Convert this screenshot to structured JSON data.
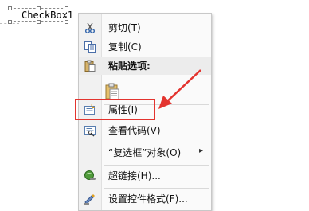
{
  "checkbox_control": {
    "label": "CheckBox1"
  },
  "context_menu": {
    "items": [
      {
        "label": "剪切(T)",
        "icon": "scissors-icon"
      },
      {
        "label": "复制(C)",
        "icon": "copy-icon"
      },
      {
        "label": "粘贴选项:",
        "icon": "paste-icon"
      },
      {
        "label": "属性(I)",
        "icon": "properties-icon"
      },
      {
        "label": "查看代码(V)",
        "icon": "view-code-icon"
      },
      {
        "label": "“复选框”对象(O)",
        "icon": "",
        "has_submenu": true
      },
      {
        "label": "超链接(H)...",
        "icon": "hyperlink-icon"
      },
      {
        "label": "设置控件格式(F)...",
        "icon": "format-control-icon"
      }
    ],
    "submenu_arrow": "▸"
  },
  "colors": {
    "annotation_red": "#e3342f"
  }
}
